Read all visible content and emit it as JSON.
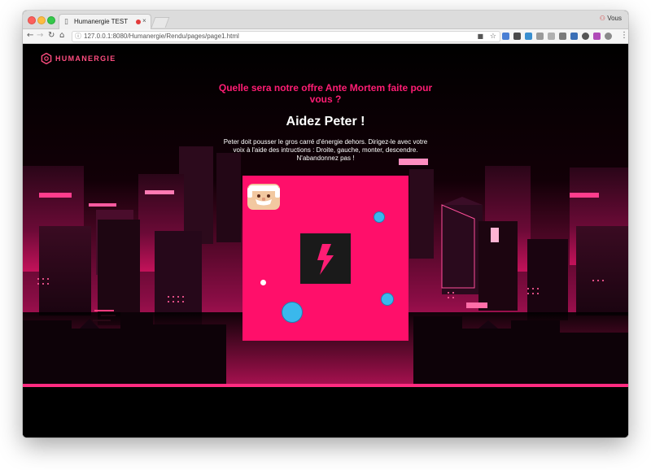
{
  "browser": {
    "tab_title": "Humanergie TEST",
    "tab_close": "×",
    "url": "127.0.0.1:8080/Humanergie/Rendu/pages/page1.html",
    "profile_label": "Vous"
  },
  "page": {
    "logo_text": "HUMANERGIE",
    "question": "Quelle sera notre offre Ante Mortem faite pour vous ?",
    "heading": "Aidez Peter !",
    "instructions_line1": "Peter doit pousser le gros carré d'énergie dehors. Dirigez-le avec votre",
    "instructions_line2": "voix à l'aide des intructions : Droite, gauche, monter, descendre.",
    "instructions_line3": "N'abandonnez pas !"
  },
  "colors": {
    "accent_pink": "#ff1d74",
    "board_pink": "#ff0f6a",
    "ball_blue": "#3ab8ec",
    "energy_box": "#1a1a1a"
  },
  "icons": {
    "energy": "lightning-bolt-icon",
    "player": "peter-avatar",
    "logo": "humanergie-logo-icon"
  }
}
